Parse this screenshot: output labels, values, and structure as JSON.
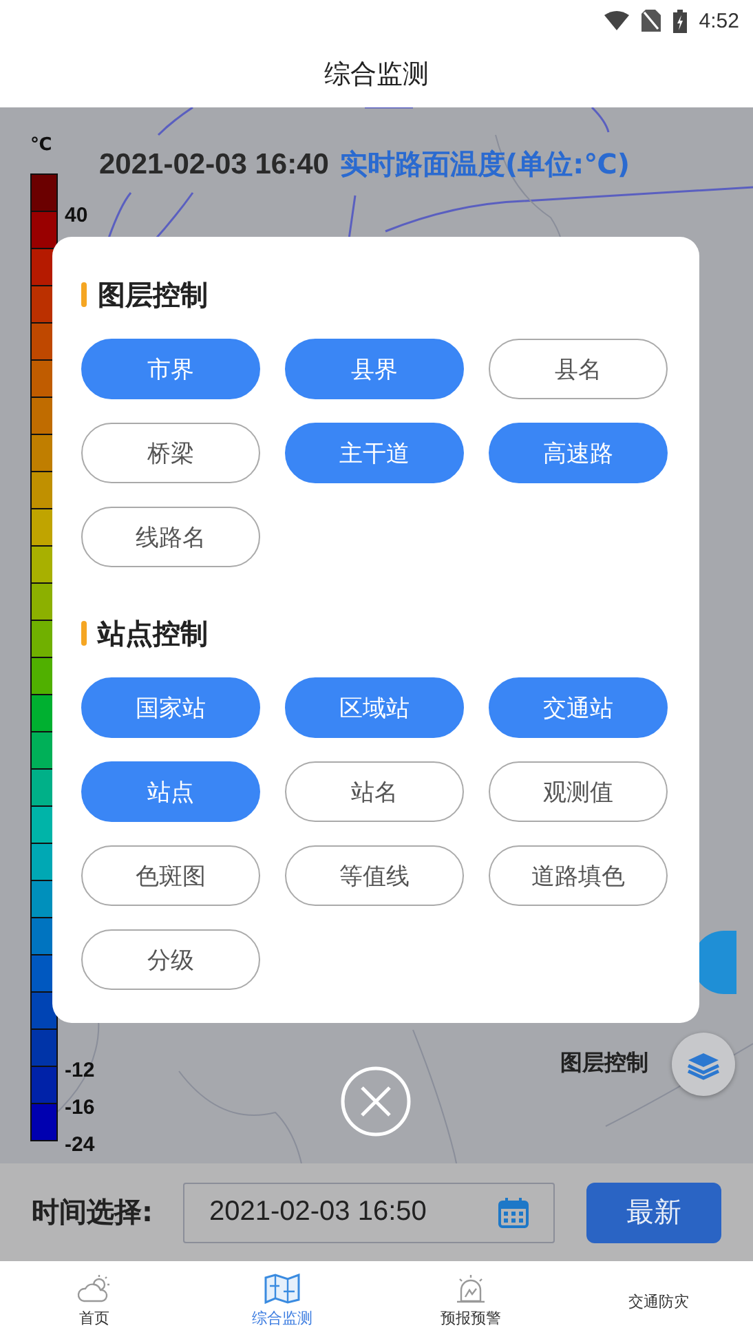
{
  "status_bar": {
    "time": "4:52"
  },
  "header": {
    "title": "综合监测"
  },
  "map": {
    "timestamp": "2021-02-03 16:40",
    "caption": "实时路面温度(单位:℃)",
    "layer_label": "图层控制",
    "legend": {
      "unit": "℃",
      "cells": [
        {
          "color": "#6b0000",
          "label": "40"
        },
        {
          "color": "#990000"
        },
        {
          "color": "#b51a00"
        },
        {
          "color": "#bb3000"
        },
        {
          "color": "#bf4800"
        },
        {
          "color": "#c05c00"
        },
        {
          "color": "#c06c00"
        },
        {
          "color": "#c07e00"
        },
        {
          "color": "#c09000"
        },
        {
          "color": "#c0a400"
        },
        {
          "color": "#a8b000"
        },
        {
          "color": "#8cb000"
        },
        {
          "color": "#70b000"
        },
        {
          "color": "#50b000"
        },
        {
          "color": "#00b030"
        },
        {
          "color": "#00b058"
        },
        {
          "color": "#00b088"
        },
        {
          "color": "#00b4a8"
        },
        {
          "color": "#00a8b4"
        },
        {
          "color": "#0090bc"
        },
        {
          "color": "#0074c0"
        },
        {
          "color": "#0058c0"
        },
        {
          "color": "#0044b4"
        },
        {
          "color": "#0034a8",
          "label": "-12"
        },
        {
          "color": "#0022a8",
          "label": "-16"
        },
        {
          "color": "#0000b0",
          "label": "-24"
        }
      ]
    }
  },
  "dialog": {
    "sections": [
      {
        "title": "图层控制",
        "options": [
          {
            "label": "市界",
            "selected": true
          },
          {
            "label": "县界",
            "selected": true
          },
          {
            "label": "县名",
            "selected": false
          },
          {
            "label": "桥梁",
            "selected": false
          },
          {
            "label": "主干道",
            "selected": true
          },
          {
            "label": "高速路",
            "selected": true
          },
          {
            "label": "线路名",
            "selected": false
          }
        ]
      },
      {
        "title": "站点控制",
        "options": [
          {
            "label": "国家站",
            "selected": true
          },
          {
            "label": "区域站",
            "selected": true
          },
          {
            "label": "交通站",
            "selected": true
          },
          {
            "label": "站点",
            "selected": true
          },
          {
            "label": "站名",
            "selected": false
          },
          {
            "label": "观测值",
            "selected": false
          },
          {
            "label": "色斑图",
            "selected": false
          },
          {
            "label": "等值线",
            "selected": false
          },
          {
            "label": "道路填色",
            "selected": false
          },
          {
            "label": "分级",
            "selected": false
          }
        ]
      }
    ]
  },
  "time_bar": {
    "label": "时间选择:",
    "value": "2021-02-03 16:50",
    "button": "最新"
  },
  "nav": [
    {
      "label": "首页",
      "kind": "cloud",
      "selected": false
    },
    {
      "label": "综合监测",
      "kind": "map",
      "selected": true
    },
    {
      "label": "预报预警",
      "kind": "alarm",
      "selected": false
    },
    {
      "label": "交通防灾",
      "kind": "plain",
      "selected": false
    }
  ]
}
